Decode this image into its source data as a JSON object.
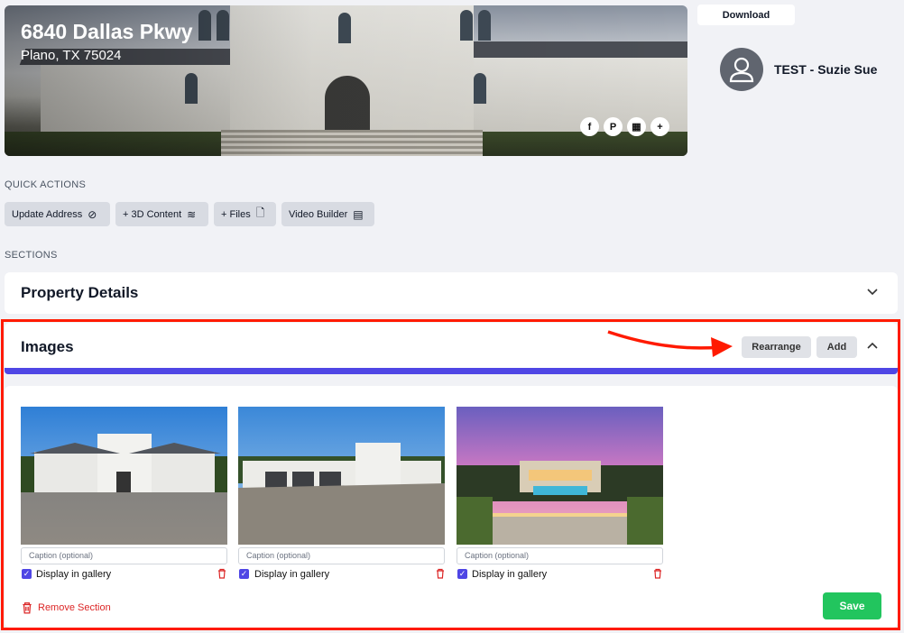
{
  "property": {
    "address": "6840 Dallas Pkwy",
    "city_line": "Plano, TX 75024"
  },
  "share_icons": [
    "facebook-icon",
    "pinterest-icon",
    "qr-code-icon",
    "plus-icon"
  ],
  "share_glyphs": [
    "f",
    "P",
    "▦",
    "+"
  ],
  "header": {
    "download_label": "Download",
    "user_name": "TEST - Suzie Sue"
  },
  "quick_actions": {
    "label": "QUICK ACTIONS",
    "items": [
      {
        "label": "Update Address",
        "icon": "compass-icon",
        "glyph": "⊘"
      },
      {
        "label": "+ 3D Content",
        "icon": "layers-icon",
        "glyph": "≋"
      },
      {
        "label": "+ Files",
        "icon": "file-plus-icon",
        "glyph": "🗋"
      },
      {
        "label": "Video Builder",
        "icon": "film-icon",
        "glyph": "▤"
      }
    ]
  },
  "sections": {
    "label": "SECTIONS",
    "property_details": {
      "title": "Property Details"
    },
    "images": {
      "title": "Images",
      "rearrange_label": "Rearrange",
      "add_label": "Add",
      "items": [
        {
          "caption_placeholder": "Caption (optional)",
          "gallery_label": "Display in gallery",
          "display_in_gallery": true
        },
        {
          "caption_placeholder": "Caption (optional)",
          "gallery_label": "Display in gallery",
          "display_in_gallery": true
        },
        {
          "caption_placeholder": "Caption (optional)",
          "gallery_label": "Display in gallery",
          "display_in_gallery": true
        }
      ],
      "remove_label": "Remove Section",
      "save_label": "Save"
    }
  },
  "colors": {
    "accent": "#4f46e5",
    "save": "#22c55e",
    "danger": "#dc2626",
    "highlight": "#ff1a00"
  }
}
